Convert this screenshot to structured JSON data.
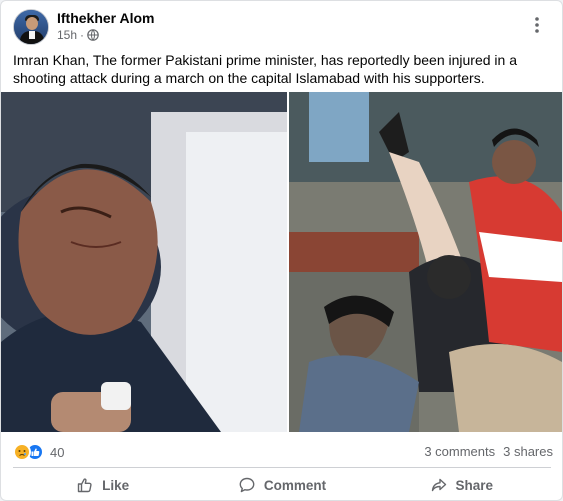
{
  "post": {
    "author": "Ifthekher Alom",
    "time": "15h",
    "separator": "·",
    "text": "Imran Khan, The  former Pakistani prime minister, has reportedly been injured in a shooting attack during a march on the capital Islamabad with his supporters."
  },
  "icons": {
    "audience": "globe-icon",
    "menu": "more-options-icon",
    "reaction_1": "sad-reaction-icon",
    "reaction_2": "like-reaction-icon"
  },
  "stats": {
    "reaction_count": "40",
    "comments": "3 comments",
    "shares": "3 shares"
  },
  "actions": {
    "like": "Like",
    "comment": "Comment",
    "share": "Share"
  },
  "colors": {
    "brand_blue": "#1877f2",
    "sad_yellow": "#f7b125",
    "secondary_text": "#65676b"
  }
}
